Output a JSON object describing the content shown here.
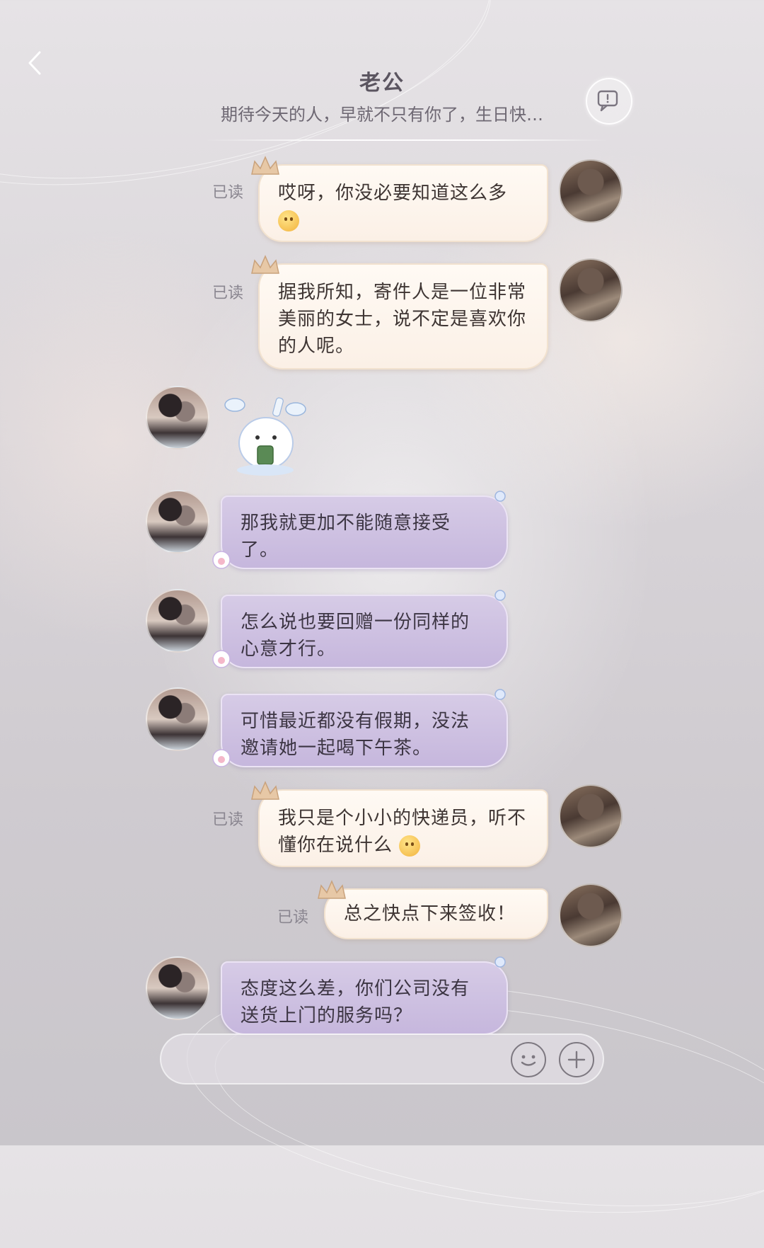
{
  "header": {
    "title": "老公",
    "subtitle": "期待今天的人，早就不只有你了，生日快…"
  },
  "read_label": "已读",
  "messages": [
    {
      "side": "out",
      "avatar": "courier-avatar",
      "read": "已读",
      "text": "哎呀，你没必要知道这么多",
      "emoji": "smirk-emoji"
    },
    {
      "side": "out",
      "avatar": "courier-avatar",
      "read": "已读",
      "text": "据我所知，寄件人是一位非常美丽的女士，说不定是喜欢你的人呢。"
    },
    {
      "side": "in",
      "avatar": "couple-avatar",
      "sticker": "bunny-drinking-tea-sticker"
    },
    {
      "side": "in",
      "avatar": "couple-avatar",
      "text": "那我就更加不能随意接受了。"
    },
    {
      "side": "in",
      "avatar": "couple-avatar",
      "text": "怎么说也要回赠一份同样的心意才行。"
    },
    {
      "side": "in",
      "avatar": "couple-avatar",
      "text": "可惜最近都没有假期，没法邀请她一起喝下午茶。"
    },
    {
      "side": "out",
      "avatar": "courier-avatar",
      "read": "已读",
      "text": "我只是个小小的快递员，听不懂你在说什么",
      "emoji": "smile-emoji"
    },
    {
      "side": "out",
      "avatar": "courier-avatar",
      "read": "已读",
      "text": "总之快点下来签收！"
    },
    {
      "side": "in",
      "avatar": "couple-avatar",
      "text": "态度这么差，你们公司没有送货上门的服务吗？"
    }
  ],
  "input": {
    "placeholder": ""
  },
  "colors": {
    "out_bubble": "#fbf0e6",
    "in_bubble": "#c6b7dd",
    "title": "#5b5560"
  }
}
